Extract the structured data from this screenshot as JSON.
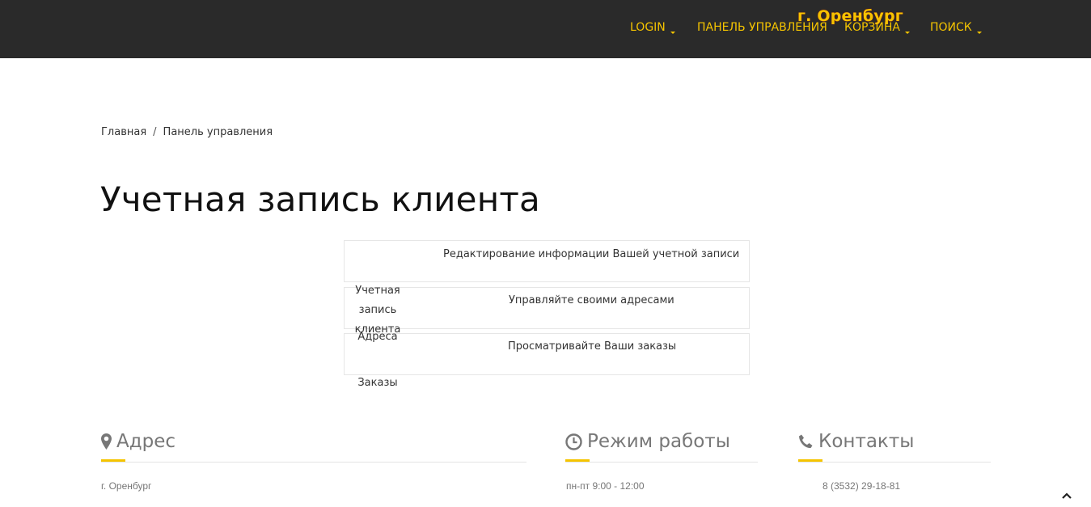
{
  "header": {
    "city": "г. Оренбург",
    "nav": [
      {
        "label": "LOGIN"
      },
      {
        "label": "ПАНЕЛЬ УПРАВЛЕНИЯ"
      },
      {
        "label": "КОРЗИНА"
      },
      {
        "label": "ПОИСК"
      }
    ]
  },
  "breadcrumb": {
    "home": "Главная",
    "separator": "/",
    "current": "Панель управления"
  },
  "page_title": "Учетная запись клиента",
  "account": {
    "items": [
      {
        "label": "Учетная запись клиента",
        "description": "Редактирование информации Вашей учетной записи"
      },
      {
        "label": "Адреса",
        "description": "Управляйте своими адресами"
      },
      {
        "label": "Заказы",
        "description": "Просматривайте Ваши заказы"
      }
    ]
  },
  "footer": {
    "address": {
      "title": "Адрес",
      "text": "г. Оренбург",
      "icon": "map-marker-icon"
    },
    "hours": {
      "title": "Режим работы",
      "text": "пн-пт 9:00 - 12:00",
      "icon": "clock-icon"
    },
    "contacts": {
      "title": "Контакты",
      "text": "8 (3532) 29-18-81",
      "icon": "phone-icon"
    }
  },
  "colors": {
    "accent": "#f5c400",
    "topbar": "#2a2a2a"
  }
}
